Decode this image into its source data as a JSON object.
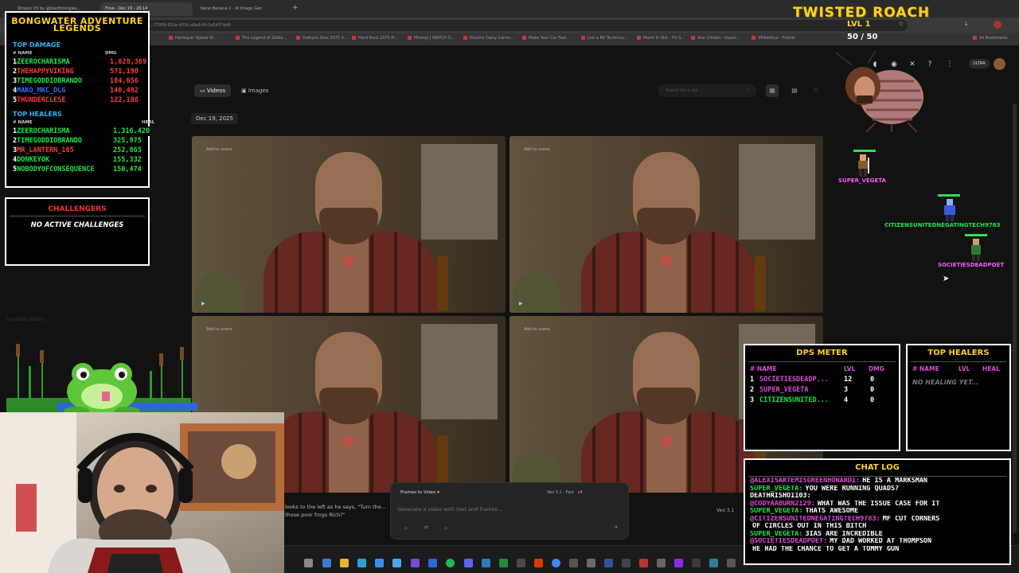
{
  "browser": {
    "tabs": [
      "Stream VS by @blazthrongwa...",
      "Flow - Dec 19 - 20:14",
      "Nano Banana 2 - AI Image Gen"
    ],
    "address": "...77956-631e-453c-a6e9-0fc7a5437dd9",
    "bookmarks": [
      "Harlequin Speed St...",
      "The Legend of Zelda...",
      "Dolbyss Zero 2075 X...",
      "Hard Rock 2075 Fr...",
      "Mhmaji | WATCH O...",
      "Electric Daisy Carniv...",
      "Make Your Car Fast...",
      "Just a Bit Technica...",
      "Monti In Skit - FU S...",
      "Star Citizen - Imper...",
      "VRAdditya - Follow",
      "All Bookmarks"
    ]
  },
  "site": {
    "tabs": {
      "videos": "Videos",
      "images": "Images"
    },
    "search_placeholder": "Search for a clip",
    "date": "Dec 19, 2025",
    "clip_label": "Add to scene",
    "caption": "looks to the left as he says, \"Turn the... those poor frogs Rich?\"",
    "composer": {
      "mode": "Frames to Video",
      "model": "Veo 3.1 - Fast",
      "count": "x4",
      "placeholder": "Generate a video with text and frames...",
      "version": "Veo 3.1"
    },
    "ultra_label": "ULTRA",
    "side_note": "Scrollbar details"
  },
  "leaderboard": {
    "title_line1": "BONGWATER ADVENTURE",
    "title_line2": "LEGENDS",
    "top_damage_label": "TOP DAMAGE",
    "col_name": "# NAME",
    "col_dmg": "DMG",
    "damage": [
      {
        "rank": "1",
        "name": "ZEEROCHARISMA",
        "value": "1,628,369",
        "color": "#1fe84a"
      },
      {
        "rank": "2",
        "name": "THEHAPPYVIKING",
        "value": "571,190",
        "color": "#ff3c3c"
      },
      {
        "rank": "3",
        "name": "TIMEGODDIOBRANDO",
        "value": "184,656",
        "color": "#1fe84a"
      },
      {
        "rank": "4",
        "name": "MAKO_MKC_DLG",
        "value": "140,482",
        "color": "#3a6bff"
      },
      {
        "rank": "5",
        "name": "THUNDERCLESE",
        "value": "122,186",
        "color": "#ff3c3c"
      }
    ],
    "top_healers_label": "TOP HEALERS",
    "col_heal": "HEAL",
    "healers": [
      {
        "rank": "1",
        "name": "ZEEROCHARISMA",
        "value": "1,316,420",
        "color": "#1fe84a"
      },
      {
        "rank": "2",
        "name": "TIMEGODDIOBRANDO",
        "value": "325,975",
        "color": "#1fe84a"
      },
      {
        "rank": "3",
        "name": "MR_LANTERN_165",
        "value": "252,865",
        "color": "#ff3c3c"
      },
      {
        "rank": "4",
        "name": "DONKEYOK",
        "value": "155,332",
        "color": "#1fe84a"
      },
      {
        "rank": "5",
        "name": "NOBODYOFCONSEQUENCE",
        "value": "150,474",
        "color": "#1fe84a"
      }
    ]
  },
  "challengers": {
    "title": "CHALLENGERS",
    "status": "NO ACTIVE CHALLENGES"
  },
  "boss": {
    "title": "TWISTED ROACH",
    "level": "LVL 1",
    "hp_current": "50",
    "hp_max": "50"
  },
  "players": [
    {
      "name": "SUPER_VEGETA",
      "hp": 1.0
    },
    {
      "name": "CITIZENSUNITEDNEGATINGTECH9783",
      "hp": 1.0
    },
    {
      "name": "SOCIETIESDEADPOET",
      "hp": 1.0
    }
  ],
  "dps_meter": {
    "title": "DPS METER",
    "col_name": "# NAME",
    "col_lvl": "LVL",
    "col_dmg": "DMG",
    "rows": [
      {
        "rank": "1",
        "name": "SOCIETIESDEADP...",
        "lvl": "12",
        "dmg": "0",
        "color": "#e04ad8"
      },
      {
        "rank": "2",
        "name": "SUPER_VEGETA",
        "lvl": "3",
        "dmg": "0",
        "color": "#e04ad8"
      },
      {
        "rank": "3",
        "name": "CITIZENSUNITED...",
        "lvl": "4",
        "dmg": "0",
        "color": "#1fe84a"
      }
    ]
  },
  "top_healers_panel": {
    "title": "TOP HEALERS",
    "col_name": "# NAME",
    "col_lvl": "LVL",
    "col_heal": "HEAL",
    "empty": "NO HEALING YET..."
  },
  "chat_log": {
    "title": "CHAT LOG",
    "messages": [
      {
        "user": "@ALEXISARTEMISGREENHOWARD1:",
        "text": "HE IS A MARKSMAN",
        "color": "#e04ad8"
      },
      {
        "user": "SUPER_VEGETA:",
        "text": "YOU WERE RUNNING QUADS?",
        "color": "#1fe84a"
      },
      {
        "user": "DEATHRISHO1103:",
        "text": "",
        "color": "#ffffff"
      },
      {
        "user": "@CODYAABURN2129:",
        "text": "WHAT WAS THE ISSUE CASE FOR IT",
        "color": "#e04ad8"
      },
      {
        "user": "SUPER_VEGETA:",
        "text": "THATS AWESOME",
        "color": "#1fe84a"
      },
      {
        "user": "@CITIZENSUNITEDNEGATINGTECH9783:",
        "text": "MF CUT CORNERS",
        "color": "#e04ad8"
      },
      {
        "user": "",
        "text": "OF CIRCLES OUT IN THIS BITCH",
        "color": "#ffffff"
      },
      {
        "user": "SUPER_VEGETA:",
        "text": "3IAS ARE INCREDIBLE",
        "color": "#1fe84a"
      },
      {
        "user": "@SOCIETIESDEADPOET:",
        "text": "MY DAD WORKED AT THOMPSON",
        "color": "#e04ad8"
      },
      {
        "user": "",
        "text": "HE HAD THE CHANCE TO GET A TOMMY GUN",
        "color": "#ffffff"
      }
    ]
  }
}
